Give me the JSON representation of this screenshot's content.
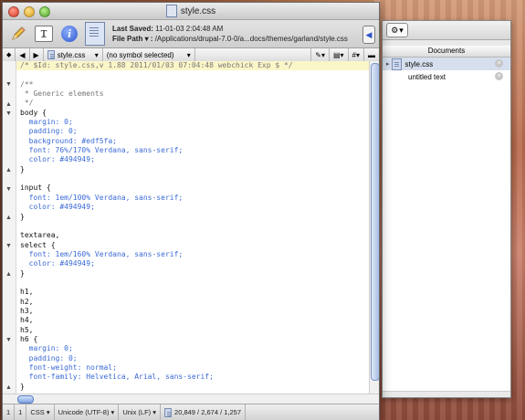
{
  "window": {
    "title": "style.css"
  },
  "toolbar": {
    "last_saved_label": "Last Saved:",
    "last_saved_value": "11-01-03 2:04:48 AM",
    "file_path_label": "File Path ▾ :",
    "file_path_value": "/Applications/drupal-7.0-0/a...docs/themes/garland/style.css",
    "textmode_glyph": "T̲",
    "info_glyph": "i"
  },
  "navbar": {
    "filename": "style.css",
    "symbol": "(no symbol selected)"
  },
  "code_lines": [
    "/* $Id: style.css,v 1.88 2011/01/03 07:04:48 webchick Exp $ */",
    "",
    "/**",
    " * Generic elements",
    " */",
    "body {",
    "  margin: 0;",
    "  padding: 0;",
    "  background: #edf5fa;",
    "  font: 76%/170% Verdana, sans-serif;",
    "  color: #494949;",
    "}",
    "",
    "input {",
    "  font: 1em/100% Verdana, sans-serif;",
    "  color: #494949;",
    "}",
    "",
    "textarea,",
    "select {",
    "  font: 1em/160% Verdana, sans-serif;",
    "  color: #494949;",
    "}",
    "",
    "h1,",
    "h2,",
    "h3,",
    "h4,",
    "h5,",
    "h6 {",
    "  margin: 0;",
    "  padding: 0;",
    "  font-weight: normal;",
    "  font-family: Helvetica, Arial, sans-serif;",
    "}"
  ],
  "status": {
    "line": "1",
    "col": "1",
    "language": "CSS",
    "encoding": "Unicode (UTF-8)",
    "line_endings": "Unix (LF)",
    "counts": "20,849 / 2,674 / 1,257"
  },
  "drawer": {
    "header": "Documents",
    "documents": [
      "style.css",
      "untitled text"
    ]
  },
  "colors": {
    "highlight_line": "#fbf6c8",
    "property": "#3a6ad6",
    "comment": "#777777"
  }
}
